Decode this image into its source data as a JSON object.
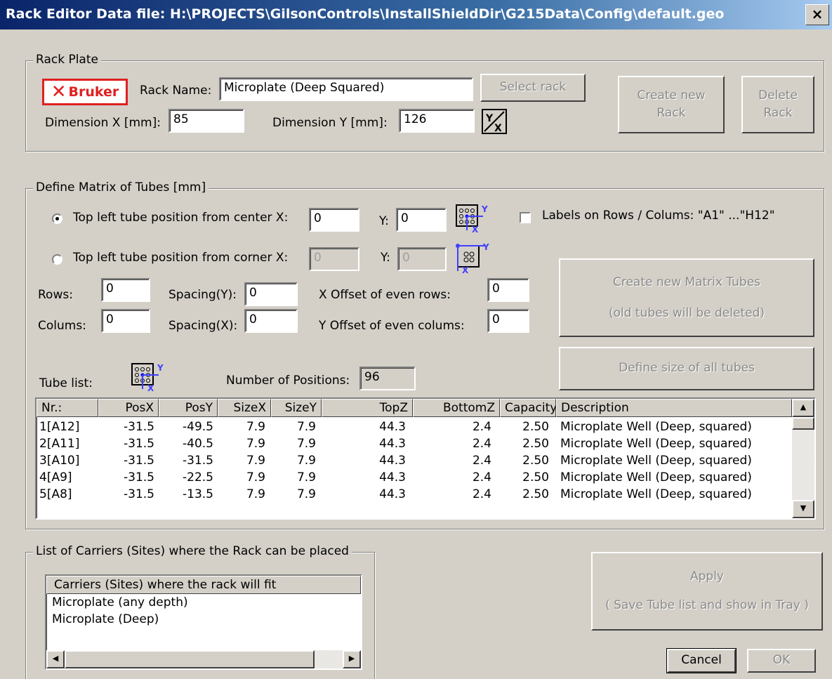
{
  "window": {
    "title": "Rack Editor  Data file: H:\\PROJECTS\\GilsonControls\\InstallShieldDir\\G215Data\\Config\\default.geo",
    "close": "×"
  },
  "rack_plate": {
    "group_title": "Rack Plate",
    "logo": {
      "x_mark": "✕",
      "text": "Bruker"
    },
    "rack_name_label": "Rack Name:",
    "rack_name_value": "Microplate (Deep Squared)",
    "select_rack": "Select rack",
    "create_new_rack": [
      "Create new",
      "Rack"
    ],
    "delete_rack": [
      "Delete",
      "Rack"
    ],
    "dim_x_label": "Dimension X [mm]:",
    "dim_x_value": "85",
    "dim_y_label": "Dimension Y [mm]:",
    "dim_y_value": "126"
  },
  "matrix": {
    "group_title": "Define Matrix of Tubes [mm]",
    "center_radio": "Top left tube position from center X:",
    "center_x": "0",
    "center_y_label": "Y:",
    "center_y": "0",
    "corner_radio": "Top left tube position from corner X:",
    "corner_x": "0",
    "corner_y_label": "Y:",
    "corner_y": "0",
    "labels_checkbox": "Labels on Rows / Colums: \"A1\" ...\"H12\"",
    "rows_label": "Rows:",
    "rows_value": "0",
    "cols_label": "Colums:",
    "cols_value": "0",
    "spacing_y_label": "Spacing(Y):",
    "spacing_y": "0",
    "spacing_x_label": "Spacing(X):",
    "spacing_x": "0",
    "x_offset_label": "X Offset of even rows:",
    "x_offset": "0",
    "y_offset_label": "Y Offset of even colums:",
    "y_offset": "0",
    "create_matrix": [
      "Create new Matrix Tubes",
      "(old tubes will be deleted)"
    ],
    "define_size": "Define size of all tubes",
    "tube_list_label": "Tube list:",
    "num_positions_label": "Number of Positions:",
    "num_positions": "96"
  },
  "tube_table": {
    "columns": [
      "Nr.:",
      "PosX",
      "PosY",
      "SizeX",
      "SizeY",
      "TopZ",
      "BottomZ",
      "Capacity",
      "Description"
    ],
    "rows": [
      [
        "1[A12]",
        "-31.5",
        "-49.5",
        "7.9",
        "7.9",
        "44.3",
        "2.4",
        "2.50",
        "Microplate Well (Deep, squared)"
      ],
      [
        "2[A11]",
        "-31.5",
        "-40.5",
        "7.9",
        "7.9",
        "44.3",
        "2.4",
        "2.50",
        "Microplate Well (Deep, squared)"
      ],
      [
        "3[A10]",
        "-31.5",
        "-31.5",
        "7.9",
        "7.9",
        "44.3",
        "2.4",
        "2.50",
        "Microplate Well (Deep, squared)"
      ],
      [
        "4[A9]",
        "-31.5",
        "-22.5",
        "7.9",
        "7.9",
        "44.3",
        "2.4",
        "2.50",
        "Microplate Well (Deep, squared)"
      ],
      [
        "5[A8]",
        "-31.5",
        "-13.5",
        "7.9",
        "7.9",
        "44.3",
        "2.4",
        "2.50",
        "Microplate Well (Deep, squared)"
      ]
    ]
  },
  "carriers": {
    "group_title": "List of Carriers (Sites) where the Rack can be placed",
    "header": "Carriers (Sites) where the rack will fit",
    "items": [
      "Microplate (any depth)",
      "Microplate (Deep)"
    ]
  },
  "buttons": {
    "apply": [
      "Apply",
      "( Save Tube list and show in Tray )"
    ],
    "cancel": "Cancel",
    "ok": "OK"
  },
  "scroll": {
    "up": "▲",
    "down": "▼",
    "left": "◀",
    "right": "▶"
  }
}
